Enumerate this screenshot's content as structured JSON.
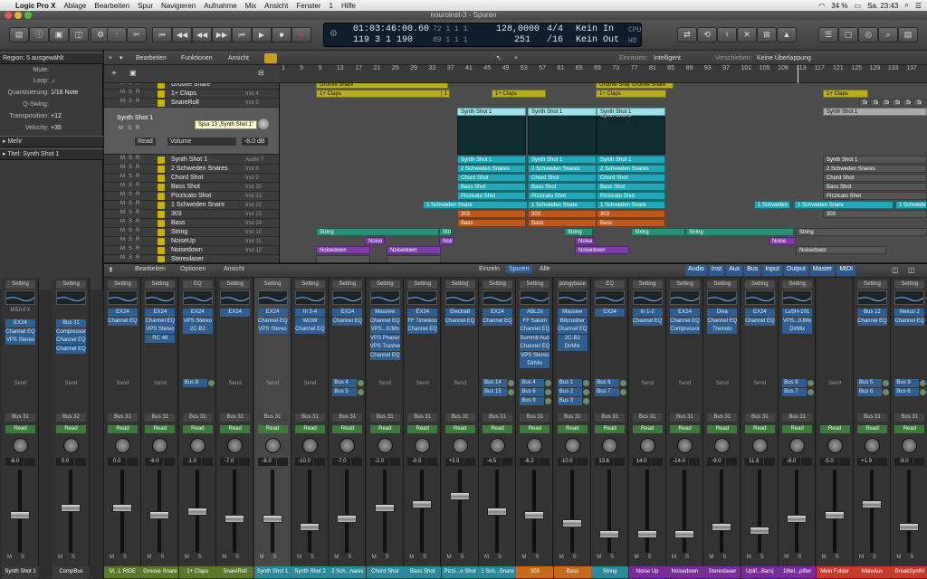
{
  "menubar": {
    "app": "Logic Pro X",
    "items": [
      "Ablage",
      "Bearbeiten",
      "Spur",
      "Navigieren",
      "Aufnahme",
      "Mix",
      "Ansicht",
      "Fenster",
      "1",
      "Hilfe"
    ],
    "battery": "34 %",
    "clock": "Sa. 23:43"
  },
  "window": {
    "title": "nouroinst-3 - Spuren"
  },
  "lcd": {
    "smpte": "01:03:46:00.60",
    "bars": "119 3 1 190",
    "tempo": "128,0000",
    "beats": "251",
    "sig": "4/4",
    "div": "/16",
    "in": "Kein In",
    "out": "Kein Out",
    "cpu": "CPU",
    "hd": "HD"
  },
  "inspector": {
    "region_header": "Region: 5 ausgewählt",
    "rows": [
      {
        "k": "Mute:",
        "v": ""
      },
      {
        "k": "Loop:",
        "v": "✓"
      },
      {
        "k": "Quantisierung:",
        "v": "1/16 Note"
      },
      {
        "k": "Q-Swing:",
        "v": ""
      },
      {
        "k": "Transposition:",
        "v": "+12"
      },
      {
        "k": "Velocity:",
        "v": "+35"
      }
    ],
    "more": "Mehr",
    "title_sect": "Titel: Synth Shot 1"
  },
  "track_toolbar": {
    "edit": "Bearbeiten",
    "functions": "Funktionen",
    "view": "Ansicht",
    "snap_label": "Einrasten:",
    "snap": "Intelligent",
    "drag_label": "Verschieben:",
    "drag": "Keine Überlappung"
  },
  "ruler": [
    "1",
    "5",
    "9",
    "13",
    "17",
    "21",
    "25",
    "29",
    "33",
    "37",
    "41",
    "45",
    "49",
    "53",
    "57",
    "61",
    "65",
    "69",
    "73",
    "77",
    "81",
    "85",
    "89",
    "93",
    "97",
    "101",
    "105",
    "109",
    "113",
    "117",
    "121",
    "125",
    "129",
    "133",
    "137"
  ],
  "expanded": {
    "name": "Synth Shot 1",
    "read": "Read",
    "param": "Volume",
    "val": "-8.0 dB",
    "tooltip": "Spur 13 „Synth Shot 1“"
  },
  "tracks_top": [
    {
      "n": "Groove Snare",
      "v": ""
    },
    {
      "n": "1+ Claps",
      "v": "Inst 4"
    },
    {
      "n": "SnareRoll",
      "v": "Inst 5"
    }
  ],
  "tracks": [
    {
      "n": "Synth Shot 1",
      "v": "Audio 7"
    },
    {
      "n": "2 Schweden Snares",
      "v": "Inst 8"
    },
    {
      "n": "Chord Shot",
      "v": "Inst 9"
    },
    {
      "n": "Bass Shot",
      "v": "Inst 20"
    },
    {
      "n": "Pizzicato Shot",
      "v": "Inst 21"
    },
    {
      "n": "1 Schweden Snare",
      "v": "Inst 22"
    },
    {
      "n": "303",
      "v": "Inst 23"
    },
    {
      "n": "Bass",
      "v": "Inst 24"
    },
    {
      "n": "String",
      "v": "Inst 10"
    },
    {
      "n": "NoiseUp",
      "v": "Inst 11"
    },
    {
      "n": "Noisedown",
      "v": "Inst 12"
    },
    {
      "n": "Stereolaser",
      "v": ""
    }
  ],
  "regions": {
    "groove": "Groove Snare",
    "claps": "1+ Claps",
    "synth": "Synth Shot 1",
    "schw2": "2 Schweden Snares",
    "chord": "Chord Shot",
    "bass_shot": "Bass Shot",
    "pizz": "Pizzicato Shot",
    "schw1": "1 Schweden Snare",
    "r303": "303",
    "bass": "Bass",
    "string": "String",
    "noise": "Noise",
    "noisedown": "Noisedown",
    "sn": "Sn"
  },
  "mixer_toolbar": {
    "edit": "Bearbeiten",
    "options": "Optionen",
    "view": "Ansicht",
    "tabs": [
      "Einzeln",
      "Spuren",
      "Alle"
    ],
    "filters": [
      "Audio",
      "Inst",
      "Aux",
      "Bus",
      "Input",
      "Output",
      "Master",
      "MIDI"
    ]
  },
  "insp_strips": [
    {
      "set": "Setting",
      "eq": "",
      "fx": "MIDI-FX",
      "plugins": [
        "EX24",
        "Channel EQ",
        "VPS Stereo"
      ],
      "send": "Send",
      "io": "Bus 31",
      "mode": "Read",
      "vol": "-6.0",
      "name": "Synth Shot 1"
    },
    {
      "set": "Setting",
      "eq": "",
      "fx": "",
      "plugins": [
        "Bus 31",
        "Compressor",
        "Channel EQ",
        "Channel EQ"
      ],
      "send": "Send",
      "io": "Bus 32",
      "mode": "Read",
      "vol": "0.0",
      "name": "CompBus"
    }
  ],
  "strips": [
    {
      "set": "Setting",
      "plugins": [
        "EX24",
        "Channel EQ"
      ],
      "buses": [],
      "io": "Bus 31",
      "mode": "Read",
      "vol": "0.0",
      "name": "M...L RIDE",
      "color": "#5a7a2a",
      "fader": 0.55
    },
    {
      "set": "Setting",
      "plugins": [
        "EX24",
        "Channel EQ",
        "VPS Stereo",
        "RC 48"
      ],
      "buses": [],
      "io": "Bus 31",
      "mode": "Read",
      "vol": "-6.0",
      "name": "Groove Snare",
      "color": "#5a7a2a",
      "fader": 0.45
    },
    {
      "set": "EQ",
      "plugins": [
        "EX24",
        "VPS Stereo",
        "2C-B2"
      ],
      "buses": [
        "Bus 8"
      ],
      "io": "Bus 31",
      "mode": "Read",
      "vol": "-1.0",
      "name": "1+ Claps",
      "color": "#5a7a2a",
      "fader": 0.5
    },
    {
      "set": "Setting",
      "plugins": [
        "EX24"
      ],
      "buses": [],
      "io": "Bus 31",
      "mode": "Read",
      "vol": "-7.0",
      "name": "SnareRoll",
      "color": "#5a7a2a",
      "fader": 0.4
    },
    {
      "set": "Setting",
      "plugins": [
        "EX24",
        "Channel EQ",
        "VPS Stereo"
      ],
      "buses": [],
      "io": "Bus 31",
      "mode": "Read",
      "vol": "-8.0",
      "name": "Synth Shot 1",
      "color": "#2a8a9a",
      "fader": 0.4
    },
    {
      "set": "Setting",
      "plugins": [
        "In 3-4",
        "WOW",
        "Channel EQ"
      ],
      "buses": [],
      "io": "Bus 31",
      "mode": "Read",
      "vol": "-10.0",
      "name": "Synth Shot 2",
      "color": "#2a8a9a",
      "fader": 0.3
    },
    {
      "set": "Setting",
      "plugins": [
        "EX24",
        "Channel EQ"
      ],
      "buses": [
        "Bus 4",
        "Bus 5"
      ],
      "io": "Bus 31",
      "mode": "Read",
      "vol": "-7.0",
      "name": "2 Sch...nares",
      "color": "#2a8a9a",
      "fader": 0.4
    },
    {
      "set": "Setting",
      "plugins": [
        "Massive",
        "Channel EQ",
        "VPS...tUMo",
        "VPS Phaser",
        "VPS Trashee",
        "Channel EQ"
      ],
      "buses": [],
      "io": "Bus 31",
      "mode": "Read",
      "vol": "-2.0",
      "name": "Chord Shot",
      "color": "#2a8a9a",
      "fader": 0.55
    },
    {
      "set": "Setting",
      "plugins": [
        "EX24",
        "FF Timeless",
        "Channel EQ"
      ],
      "buses": [],
      "io": "Bus 31",
      "mode": "Read",
      "vol": "-0.5",
      "name": "Bass Shot",
      "color": "#2a8a9a",
      "fader": 0.6
    },
    {
      "set": "Setting",
      "plugins": [
        "Electra8",
        "Channel EQ"
      ],
      "buses": [],
      "io": "Bus 31",
      "mode": "Read",
      "vol": "+3.5",
      "name": "Pizzi...o Shot",
      "color": "#2a8a9a",
      "fader": 0.7
    },
    {
      "set": "Setting",
      "plugins": [
        "EX24",
        "Channel EQ"
      ],
      "buses": [
        "Bus 14",
        "Bus 15"
      ],
      "io": "Bus 31",
      "mode": "Read",
      "vol": "-4.5",
      "name": "1 Sch...Snare",
      "color": "#2a8a9a",
      "fader": 0.5
    },
    {
      "set": "Setting",
      "plugins": [
        "ABL2x",
        "FF Saturn",
        "Channel EQ",
        "Summit Audi",
        "Channel EQ",
        "VPS Stereo",
        "DirMix"
      ],
      "buses": [
        "Bus 4",
        "Bus 6",
        "Bus 9"
      ],
      "io": "Bus 31",
      "mode": "Read",
      "vol": "-6.2",
      "name": "303",
      "color": "#c86a1a",
      "fader": 0.45
    },
    {
      "set": "pongybase",
      "plugins": [
        "Massive",
        "Bitcrusher",
        "Channel EQ",
        "2C-B2",
        "DirMix"
      ],
      "buses": [
        "Bus 1",
        "Bus 2",
        "Bus 3"
      ],
      "io": "Bus 31",
      "mode": "Read",
      "vol": "-10.0",
      "name": "Bass",
      "color": "#c86a1a",
      "fader": 0.35
    },
    {
      "set": "EQ",
      "plugins": [
        "EX24"
      ],
      "buses": [
        "Bus 6",
        "Bus 7"
      ],
      "io": "Bus 31",
      "mode": "Read",
      "vol": "13.6",
      "name": "String",
      "color": "#2a8a9a",
      "fader": 0.2
    },
    {
      "set": "Setting",
      "plugins": [
        "In 1-2",
        "Channel EQ"
      ],
      "buses": [],
      "io": "Bus 31",
      "mode": "Read",
      "vol": "14.0",
      "name": "Noise Up",
      "color": "#7a2a9a",
      "fader": 0.2
    },
    {
      "set": "Setting",
      "plugins": [
        "EX24",
        "Channel EQ",
        "Compressor"
      ],
      "buses": [],
      "io": "Bus 31",
      "mode": "Read",
      "vol": "-14.0",
      "name": "Noisedown",
      "color": "#7a2a9a",
      "fader": 0.2
    },
    {
      "set": "Setting",
      "plugins": [
        "Diva",
        "Channel EQ",
        "Tremolo"
      ],
      "buses": [],
      "io": "Bus 31",
      "mode": "Read",
      "vol": "-9.0",
      "name": "Stereolaser",
      "color": "#7a2a9a",
      "fader": 0.3
    },
    {
      "set": "Setting",
      "plugins": [
        "EX24",
        "Channel EQ"
      ],
      "buses": [],
      "io": "Bus 31",
      "mode": "Read",
      "vol": "11.8",
      "name": "Uplif...Barsj",
      "color": "#7a2a9a",
      "fader": 0.25
    },
    {
      "set": "Setting",
      "plugins": [
        "LuSH-101",
        "VPS...tUMo",
        "DirMix"
      ],
      "buses": [
        "Bus 6",
        "Bus 7"
      ],
      "io": "Bus 31",
      "mode": "Read",
      "vol": "-8.0",
      "name": "16tel...pifter",
      "color": "#7a2a9a",
      "fader": 0.4
    },
    {
      "set": "",
      "plugins": [],
      "buses": [],
      "io": "",
      "mode": "Read",
      "vol": "-5.0",
      "name": "Melo Folder",
      "color": "#c83a2a",
      "fader": 0.45
    },
    {
      "set": "Setting",
      "plugins": [
        "Bus 12",
        "Channel EQ"
      ],
      "buses": [
        "Bus 5",
        "Bus 6"
      ],
      "io": "Bus 31",
      "mode": "Read",
      "vol": "+1.9",
      "name": "MeloAux",
      "color": "#c83a2a",
      "fader": 0.6
    },
    {
      "set": "Setting",
      "plugins": [
        "Nexus 2",
        "Channel EQ"
      ],
      "buses": [
        "Bus 9",
        "Bus 6"
      ],
      "io": "Bus 31",
      "mode": "Read",
      "vol": "-9.0",
      "name": "BreakSynth!",
      "color": "#c83a2a",
      "fader": 0.3
    }
  ]
}
